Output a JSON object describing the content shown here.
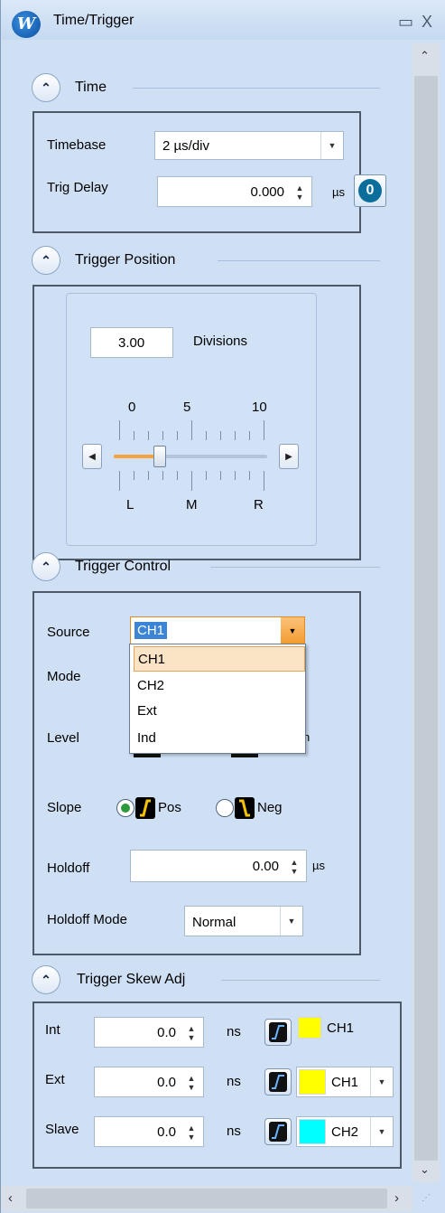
{
  "window": {
    "title": "Time/Trigger",
    "minimize_glyph": "▭",
    "close_glyph": "X"
  },
  "sections": {
    "time": "Time",
    "trigger_position": "Trigger Position",
    "trigger_control": "Trigger Control",
    "trigger_skew": "Trigger Skew Adj"
  },
  "time": {
    "timebase_label": "Timebase",
    "timebase_value": "2  µs/div",
    "trig_delay_label": "Trig Delay",
    "trig_delay_value": "0.000",
    "trig_delay_unit": "µs",
    "zero_button_label": "0"
  },
  "trigger_position": {
    "value": "3.00",
    "unit_label": "Divisions",
    "scale_top": [
      "0",
      "5",
      "10"
    ],
    "scale_bottom": [
      "L",
      "M",
      "R"
    ],
    "slider_fraction": 0.3
  },
  "trigger_control": {
    "source_label": "Source",
    "source_value": "CH1",
    "source_options": [
      "CH1",
      "CH2",
      "Ext",
      "Ind"
    ],
    "mode_label": "Mode",
    "level_label": "Level",
    "slope_label": "Slope",
    "slope_pos": "Pos",
    "slope_neg": "Neg",
    "slope_selected": "Pos",
    "holdoff_label": "Holdoff",
    "holdoff_value": "0.00",
    "holdoff_unit": "µs",
    "holdoff_mode_label": "Holdoff Mode",
    "holdoff_mode_value": "Normal"
  },
  "skew": {
    "rows": [
      {
        "label": "Int",
        "value": "0.0",
        "unit": "ns",
        "channel": "CH1",
        "color": "#ffff00",
        "has_dropdown": false
      },
      {
        "label": "Ext",
        "value": "0.0",
        "unit": "ns",
        "channel": "CH1",
        "color": "#ffff00",
        "has_dropdown": true
      },
      {
        "label": "Slave",
        "value": "0.0",
        "unit": "ns",
        "channel": "CH2",
        "color": "#00ffff",
        "has_dropdown": true
      }
    ]
  },
  "colors": {
    "accent_orange": "#f7a23a",
    "highlight_blue": "#3b84d6",
    "dropdown_hover": "#fbe3c6"
  }
}
